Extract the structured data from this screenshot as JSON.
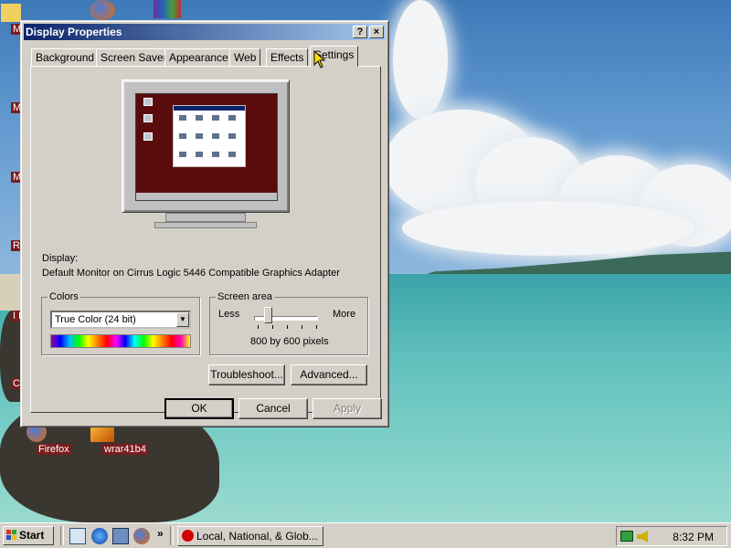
{
  "desktop": {
    "icons": [
      {
        "label": "My D",
        "icon": "my-documents-icon"
      },
      {
        "label": "My",
        "icon": "my-computer-icon"
      },
      {
        "label": "My",
        "icon": "my-network-icon"
      },
      {
        "label": "Re",
        "icon": "recycle-bin-icon"
      },
      {
        "label": "I E",
        "icon": "internet-explorer-icon"
      },
      {
        "label": "Con I",
        "icon": "connect-icon"
      },
      {
        "label": "Firefox",
        "icon": "firefox-icon"
      },
      {
        "label": "wrar41b4",
        "icon": "winrar-installer-icon"
      }
    ]
  },
  "window": {
    "title": "Display Properties",
    "help_button": "?",
    "close_button": "×",
    "tabs": [
      {
        "label": "Background",
        "active": false
      },
      {
        "label": "Screen Saver",
        "active": false
      },
      {
        "label": "Appearance",
        "active": false
      },
      {
        "label": "Web",
        "active": false
      },
      {
        "label": "Effects",
        "active": false
      },
      {
        "label": "Settings",
        "active": true
      }
    ],
    "settings": {
      "display_label": "Display:",
      "display_value": "Default Monitor on Cirrus Logic 5446 Compatible Graphics Adapter",
      "colors": {
        "group_label": "Colors",
        "selected": "True Color (24 bit)"
      },
      "screen_area": {
        "group_label": "Screen area",
        "less_label": "Less",
        "more_label": "More",
        "value_text": "800 by 600 pixels",
        "slider_level": 0.2
      },
      "troubleshoot_button": "Troubleshoot...",
      "advanced_button": "Advanced..."
    },
    "buttons": {
      "ok": "OK",
      "cancel": "Cancel",
      "apply": "Apply"
    }
  },
  "taskbar": {
    "start_label": "Start",
    "quick_launch": [
      "show-desktop-icon",
      "internet-explorer-icon",
      "outlook-icon",
      "firefox-icon"
    ],
    "chevron": "»",
    "task_button_label": "Local, National, & Glob...",
    "clock": "8:32 PM",
    "tray_icons": [
      "network-icon",
      "volume-icon"
    ]
  },
  "colors": {
    "title_bar_start": "#0a246a",
    "title_bar_end": "#a6caf0",
    "face": "#d4d0c8",
    "preview_desktop": "#5a0c0c"
  }
}
